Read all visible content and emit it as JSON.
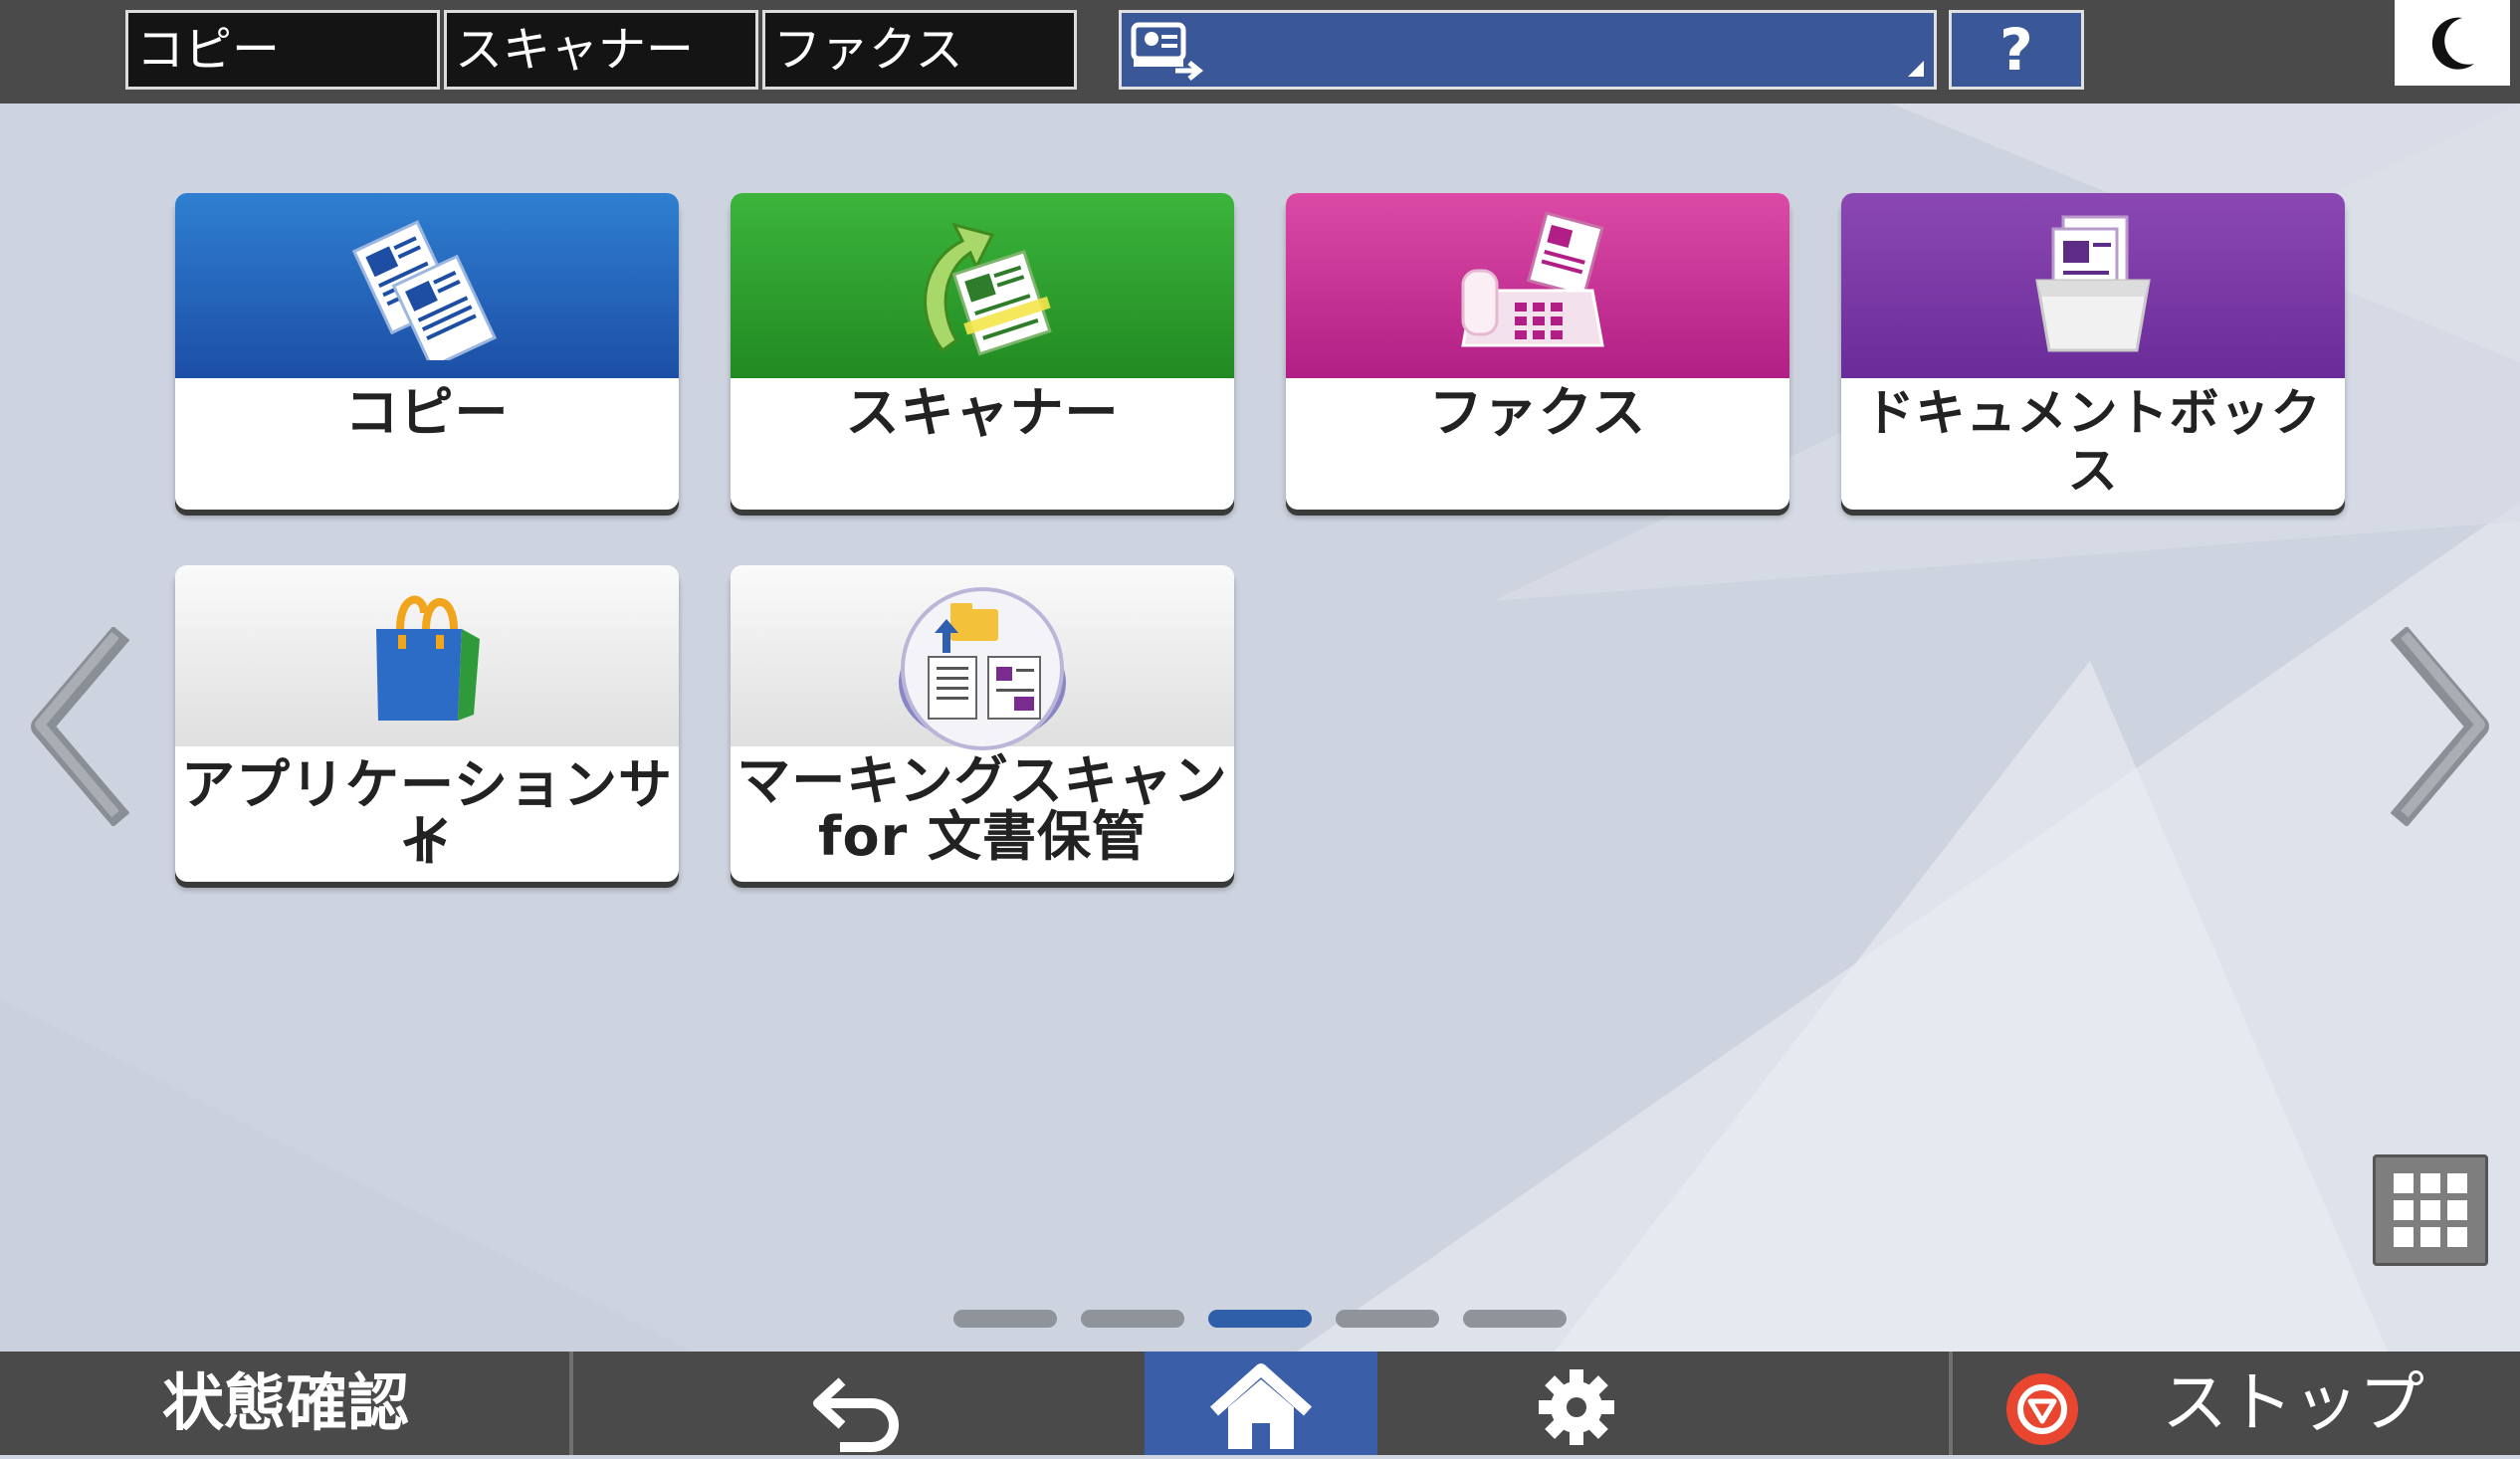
{
  "topbar": {
    "shortcuts": [
      "コピー",
      "スキャナー",
      "ファクス"
    ],
    "help_label": "?"
  },
  "tiles": [
    {
      "label": "コピー",
      "icon": "copy-icon",
      "color": "#1c4fa6"
    },
    {
      "label": "スキャナー",
      "icon": "scanner-icon",
      "color": "#218a22"
    },
    {
      "label": "ファクス",
      "icon": "fax-icon",
      "color": "#b11f86"
    },
    {
      "label": "ドキュメントボックス",
      "icon": "document-box-icon",
      "color": "#6a2c99"
    },
    {
      "label_line1": "アプリケーションサイ",
      "label_line2": "ト",
      "icon": "shopping-bag-icon"
    },
    {
      "label_line1": "マーキングスキャン",
      "label_line2": "for 文書保管",
      "icon": "marking-scan-icon"
    }
  ],
  "pager": {
    "count": 5,
    "active_index": 2
  },
  "bottombar": {
    "status_label": "状態確認",
    "stop_label": "ストップ"
  },
  "colors": {
    "accent": "#3a5fa8",
    "topbar": "#4a4a4a",
    "stop": "#e8462e"
  }
}
